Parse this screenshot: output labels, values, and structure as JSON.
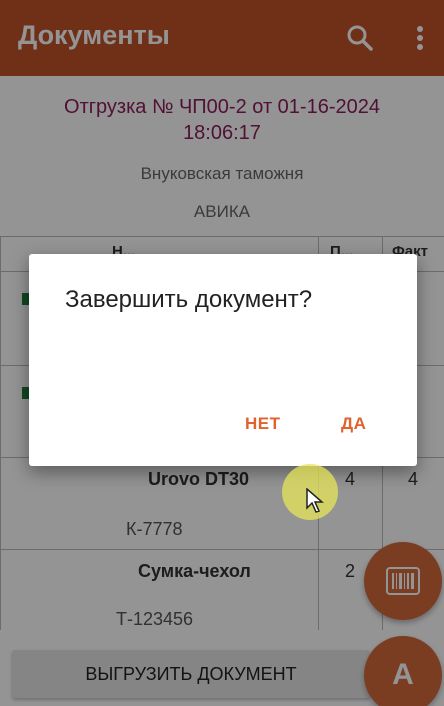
{
  "appbar": {
    "title": "Документы",
    "search_icon": "search-icon",
    "menu_icon": "more-vert-icon"
  },
  "document": {
    "title_line1": "Отгрузка № ЧП00-2 от 01-16-2024",
    "title_line2": "18:06:17",
    "customs": "Внуковская таможня",
    "company": "АВИКА"
  },
  "table": {
    "headers": [
      "Н...",
      "П...",
      "Факт"
    ],
    "rows": [
      {
        "name": "",
        "code": "",
        "plan": "",
        "fact": ""
      },
      {
        "name": "",
        "code": "",
        "plan": "",
        "fact": ""
      },
      {
        "name": "Urovo DT30",
        "code": "К-7778",
        "plan": "4",
        "fact": "4"
      },
      {
        "name": "Сумка-чехол",
        "code": "Т-123456",
        "plan": "2",
        "fact": ""
      }
    ]
  },
  "upload_button": "ВЫГРУЗИТЬ ДОКУМЕНТ",
  "fab_barcode_icon": "barcode-icon",
  "fab_a_label": "А",
  "dialog": {
    "title": "Завершить документ?",
    "no": "НЕТ",
    "yes": "ДА"
  },
  "colors": {
    "primary": "#c2542a",
    "accent": "#e0622e",
    "title": "#8c1d5c"
  }
}
